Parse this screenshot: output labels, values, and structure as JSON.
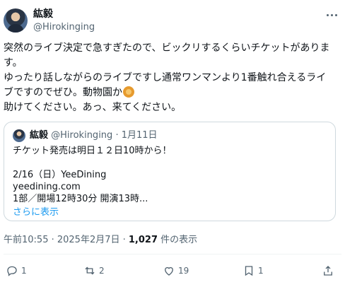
{
  "author": {
    "name": "紘毅",
    "handle": "@Hirokinging"
  },
  "tweet": {
    "lines": [
      "突然のライブ決定で急すぎたので、ビックリするくらいチケットがありま",
      "す。",
      "ゆったり話しながらのライブですし通常ワンマンより1番触れ合えるライ",
      "ブですのでぜひ。動物園か",
      "助けてください。あっ、来てください。"
    ],
    "emoji_icon": "lion-face-icon"
  },
  "quote": {
    "name": "紘毅",
    "handle": "@Hirokinging",
    "date": "· 1月11日",
    "lines": [
      "チケット発売は明日１２日10時から！",
      "",
      "2/16（日）YeeDining",
      "yeedining.com",
      "1部／開場12時30分 開演13時..."
    ],
    "show_more": "さらに表示"
  },
  "meta": {
    "time": "午前10:55 · 2025年2月7日 · ",
    "views": "1,027",
    "views_label": " 件の表示"
  },
  "actions": {
    "replies": "1",
    "reposts": "2",
    "likes": "19",
    "bookmarks": "1"
  }
}
